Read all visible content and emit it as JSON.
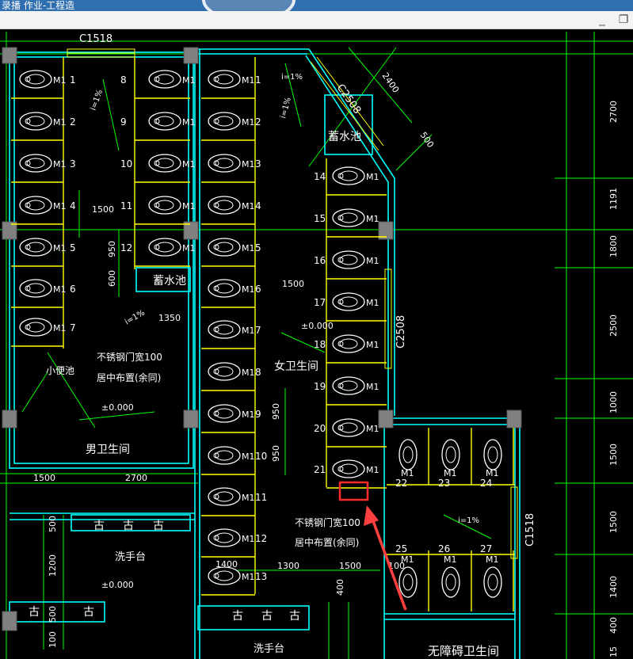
{
  "window": {
    "title": "录播 作业-工程造",
    "min_glyph": "_",
    "restore_glyph": "❐"
  },
  "colors": {
    "wall": "#00ffff",
    "stall": "#ffff00",
    "dim": "#00ff00",
    "text": "#ffffff",
    "column": "#808080",
    "highlight": "#ff2a2a",
    "arrow": "#ff4040"
  },
  "icons": {
    "minimize": "minimize-icon",
    "restore": "restore-icon"
  },
  "drawing": {
    "labels": {
      "c1518_top": "C1518",
      "c2508_diag": "C2508",
      "c2508_right": "C2508",
      "c1518_right": "C1518",
      "storage_tank_1": "蓄水池",
      "storage_tank_2": "蓄水池",
      "mens_room": "男卫生间",
      "womens_room": "女卫生间",
      "urinal_trough": "小便池",
      "steel_door_1": "不锈钢门宽100",
      "steel_door_1b": "居中布置(余同)",
      "steel_door_2": "不锈钢门宽100",
      "steel_door_2b": "居中布置(余同)",
      "sink_1": "洗手台",
      "sink_2": "洗手台",
      "accessible": "无障碍卫生间",
      "elev_1": "±0.000",
      "elev_2": "±0.000",
      "elev_3": "±0.000",
      "slope_1": "i=1%",
      "slope_2": "i=1%",
      "slope_3": "i=1%",
      "slope_4": "i=1%",
      "slope_5": "i=1%"
    },
    "dims": {
      "d1500a": "1500",
      "d950a": "950",
      "d600": "600",
      "d1350": "1350",
      "d1500b": "1500",
      "d2700": "2700",
      "d1500c": "1500",
      "d950b": "950",
      "d950c": "950",
      "d1300": "1300",
      "d1500d": "1500",
      "d1400": "1400",
      "d100": "100",
      "d400": "400",
      "d500a": "500",
      "d1200": "1200",
      "d500b": "500",
      "d100b": "100",
      "d2400": "2400",
      "d500c": "500",
      "r2700": "2700",
      "r1191": "1191",
      "r1800": "1800",
      "r2500": "2500",
      "r1000": "1000",
      "r1500a": "1500",
      "r1500b": "1500",
      "r1400": "1400",
      "r400": "400",
      "r15": "15"
    },
    "stall_label": "M1",
    "stall_numbers": [
      "1",
      "2",
      "3",
      "4",
      "5",
      "6",
      "7",
      "8",
      "9",
      "10",
      "11",
      "12",
      "13",
      "14",
      "15",
      "16",
      "17",
      "18",
      "19",
      "20",
      "21",
      "22",
      "23",
      "24",
      "25",
      "26",
      "27"
    ],
    "sink_glyph": "古"
  }
}
